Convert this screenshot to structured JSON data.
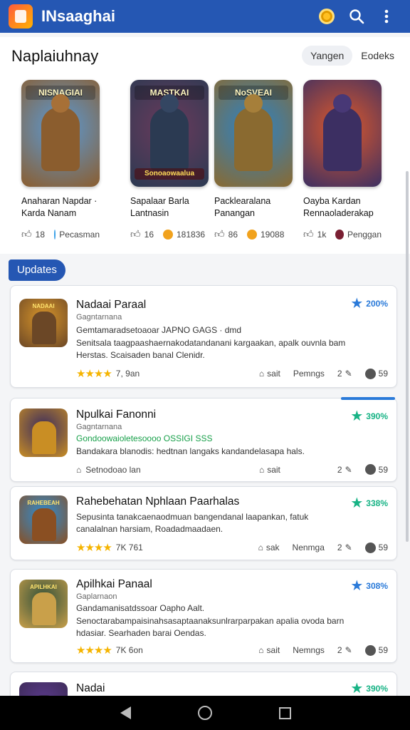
{
  "header": {
    "title": "INsaaghai"
  },
  "section": {
    "title": "Naplaiuhnay",
    "tabs": [
      "Yangen",
      "Eodeks"
    ]
  },
  "featured": [
    {
      "banner": "NISNAGIAI",
      "banner2": "",
      "name": "Anaharan Napdar · Karda Nanam",
      "likes": "18",
      "meta": "Pecasman",
      "dot": "#3aa0e8",
      "palette": [
        "#5a9ad6",
        "#8b5d2e"
      ]
    },
    {
      "banner": "MASTKAI",
      "banner2": "Sonoaowaalua",
      "name": "Sapalaar Barla Lantnasin",
      "likes": "16",
      "meta": "181836",
      "dot": "#f1a21d",
      "palette": [
        "#6b3a5c",
        "#2b3a52"
      ]
    },
    {
      "banner": "NoSVEAI",
      "banner2": "",
      "name": "Packlearalana Panangan",
      "likes": "86",
      "meta": "19088",
      "dot": "#f1a21d",
      "palette": [
        "#2a83c9",
        "#8a6a30"
      ]
    },
    {
      "banner": "",
      "banner2": "",
      "name": "Oayba Kardan Rennaoladerakap",
      "likes": "1k",
      "meta": "Penggan",
      "dot": "#7a1f33",
      "palette": [
        "#e0592a",
        "#3c2f62"
      ]
    }
  ],
  "updates": {
    "label": "Updates"
  },
  "list": [
    {
      "title": "Nadaai Paraal",
      "sub": "Gagntarnana",
      "subline": "Gemtamaradsetoaoar JAPNO GAGS · dmd",
      "desc": "Senitsala taagpaashaernakodatandanani kargaakan, apalk ouvnla bam Herstas. Scaisaden banal Clenidr.",
      "badge": "200%",
      "badge_color": "#2a7ad9",
      "rating_stars": "★★★★",
      "rating": "7, 9an",
      "foot": [
        "sait",
        "Pemngs",
        "2",
        "59"
      ],
      "palette": [
        "#d9962a",
        "#6b4726"
      ],
      "icon_label": "NADAAI"
    },
    {
      "title": "Npulkai Fanonni",
      "sub": "Gagntarnana",
      "subline": "Gondoowaioletesoooo OSSIGI SSS",
      "desc": "Bandakara blanodis: hedtnan langaks kandandelasapa hals.",
      "badge": "390%",
      "badge_color": "#17b385",
      "rating_stars": "",
      "rating": "Setnodoao lan",
      "foot": [
        "sait",
        "",
        "2",
        "59"
      ],
      "palette": [
        "#3a2b5e",
        "#c98e24"
      ],
      "icon_label": ""
    },
    {
      "title": "Rahebehatan Nphlaan Paarhalas",
      "sub": "",
      "subline": "",
      "desc": "Sepusinta tanakcaenaodmuan bangendanal laapankan, fatuk canalalnan harsiam, Roadadmaadaen.",
      "badge": "338%",
      "badge_color": "#17b385",
      "rating_stars": "★★★★",
      "rating": "7K 761",
      "foot": [
        "sak",
        "Nenmga",
        "2",
        "59"
      ],
      "palette": [
        "#2b8ed6",
        "#8a4f22"
      ],
      "icon_label": "RAHEBEAH"
    },
    {
      "title": "Apilhkai Panaal",
      "sub": "Gaplarnaon",
      "subline": "Gandamanisatdssoar Oapho Aalt.",
      "desc": "Senoctarabampaisinahsasaptaanaksunlrarparpakan apalia ovoda barn hdasiar. Searhaden barai Oendas.",
      "badge": "308%",
      "badge_color": "#2a7ad9",
      "rating_stars": "★★★★",
      "rating": "7K 6on",
      "foot": [
        "sait",
        "Nemngs",
        "2",
        "59"
      ],
      "palette": [
        "#2f4f3a",
        "#c9a04a"
      ],
      "icon_label": "APILHKAI"
    },
    {
      "title": "Nadai",
      "sub": "",
      "subline": "",
      "desc": "",
      "badge": "390%",
      "badge_color": "#17b385",
      "rating_stars": "",
      "rating": "",
      "foot": [
        "",
        "",
        "",
        ""
      ],
      "palette": [
        "#5a3a8a",
        "#3a2a52"
      ],
      "icon_label": ""
    }
  ]
}
